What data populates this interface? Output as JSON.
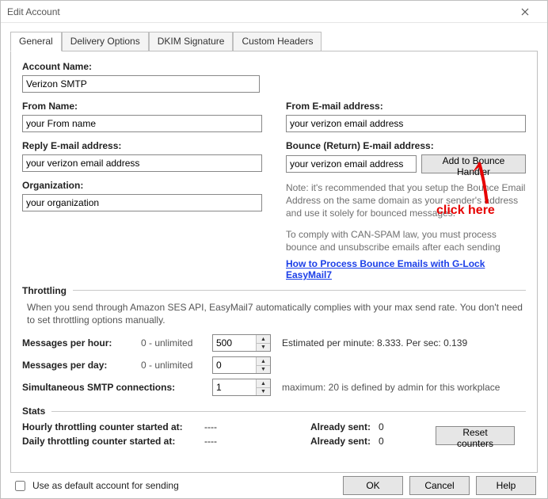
{
  "window": {
    "title": "Edit Account"
  },
  "tabs": [
    "General",
    "Delivery Options",
    "DKIM Signature",
    "Custom Headers"
  ],
  "account_name": {
    "label": "Account Name:",
    "value": "Verizon SMTP"
  },
  "from_name": {
    "label": "From Name:",
    "value": "your From name"
  },
  "from_email": {
    "label": "From E-mail address:",
    "value": "your verizon email address"
  },
  "reply_email": {
    "label": "Reply E-mail address:",
    "value": "your verizon email address"
  },
  "bounce_email": {
    "label": "Bounce (Return) E-mail address:",
    "value": "your verizon email address"
  },
  "organization": {
    "label": "Organization:",
    "value": "your organization"
  },
  "buttons": {
    "add_bounce": "Add to Bounce Handler",
    "reset_counters": "Reset counters",
    "ok": "OK",
    "cancel": "Cancel",
    "help": "Help"
  },
  "notes": {
    "bounce1": "Note: it's recommended that you setup the Bounce Email Address on the same domain as your sender's address and use it solely for bounced messages.",
    "bounce2": "To comply with CAN-SPAM law, you must process bounce and unsubscribe emails after each sending",
    "link": "How to Process Bounce Emails with G-Lock EasyMail7"
  },
  "throttling": {
    "header": "Throttling",
    "intro": "When you send through Amazon SES API, EasyMail7 automatically complies with your max send rate. You don't need to set throttling options manually.",
    "per_hour": {
      "label": "Messages per hour:",
      "hint": "0 - unlimited",
      "value": "500",
      "after": "Estimated per minute: 8.333. Per sec: 0.139"
    },
    "per_day": {
      "label": "Messages per day:",
      "hint": "0 - unlimited",
      "value": "0"
    },
    "smtp_conn": {
      "label": "Simultaneous SMTP connections:",
      "value": "1",
      "after": "maximum: 20 is defined by admin for this workplace"
    }
  },
  "stats": {
    "header": "Stats",
    "hourly_label": "Hourly throttling counter started at:",
    "hourly_value": "----",
    "daily_label": "Daily throttling counter started at:",
    "daily_value": "----",
    "already_sent_label": "Already sent:",
    "already_sent_hourly": "0",
    "already_sent_daily": "0"
  },
  "default_checkbox": "Use as default account for sending",
  "annotation": "click here"
}
